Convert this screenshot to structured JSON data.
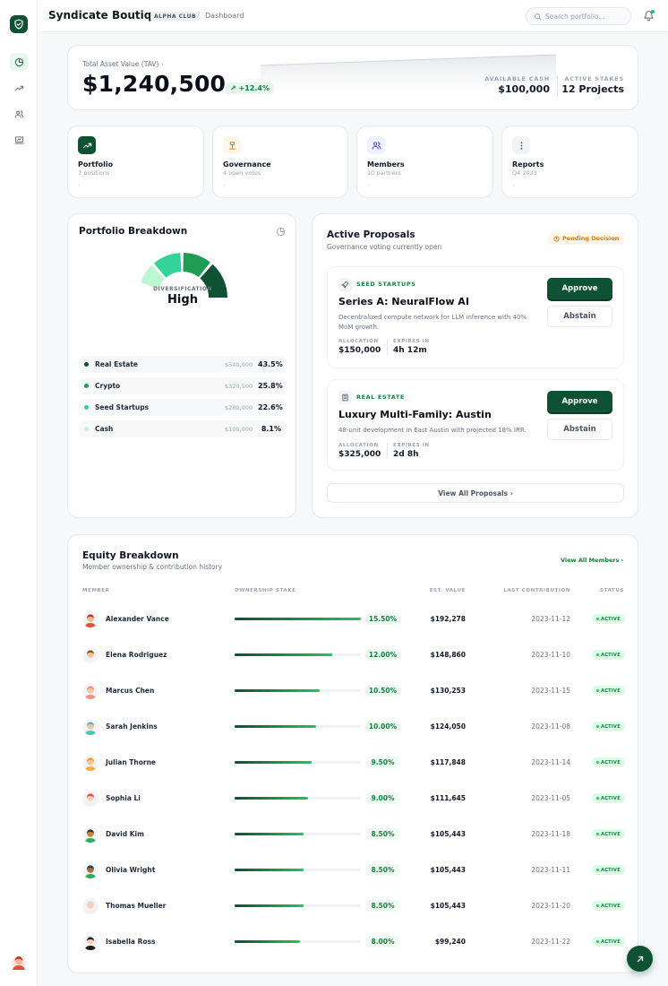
{
  "app": {
    "title": "Syndicate Boutique",
    "badge": "ALPHA CLUB",
    "crumb": "Dashboard"
  },
  "search": {
    "placeholder": "Search portfolio..."
  },
  "sidebar": {
    "items": [
      "pie-chart-icon",
      "trending-up-icon",
      "users-icon",
      "presentation-icon"
    ]
  },
  "tav": {
    "label": "Total Asset Value (TAV)",
    "value": "$1,240,500",
    "change": "+12.4%",
    "cash_label": "AVAILABLE CASH",
    "cash_value": "$100,000",
    "stakes_label": "ACTIVE STAKES",
    "stakes_value": "12 Projects"
  },
  "quick": [
    {
      "title": "Portfolio",
      "sub": "7 positions",
      "icon": "trending-up-icon"
    },
    {
      "title": "Governance",
      "sub": "4 open votes",
      "icon": "gavel-icon"
    },
    {
      "title": "Members",
      "sub": "10 partners",
      "icon": "users-icon"
    },
    {
      "title": "Reports",
      "sub": "Q4 2023",
      "icon": "more-vertical-icon"
    }
  ],
  "breakdown": {
    "title": "Portfolio Breakdown",
    "div_label": "DIVERSIFICATION",
    "div_value": "High",
    "items": [
      {
        "name": "Real Estate",
        "amount": "$540,000",
        "pct": "43.5%",
        "color": "#0f5133"
      },
      {
        "name": "Crypto",
        "amount": "$320,500",
        "pct": "25.8%",
        "color": "#1f9d55"
      },
      {
        "name": "Seed Startups",
        "amount": "$280,000",
        "pct": "22.6%",
        "color": "#34d399"
      },
      {
        "name": "Cash",
        "amount": "$100,000",
        "pct": "8.1%",
        "color": "#bbf7d0"
      }
    ]
  },
  "proposals": {
    "title": "Active Proposals",
    "sub": "Governance voting currently open",
    "pending": "Pending Decision",
    "items": [
      {
        "category": "SEED STARTUPS",
        "icon": "rocket-icon",
        "title": "Series A: NeuralFlow AI",
        "desc": "Decentralized compute network for LLM inference with 40% MoM growth.",
        "alloc_label": "ALLOCATION",
        "alloc": "$150,000",
        "exp_label": "EXPIRES IN",
        "expires": "4h 12m"
      },
      {
        "category": "REAL ESTATE",
        "icon": "building-icon",
        "title": "Luxury Multi-Family: Austin",
        "desc": "48-unit development in East Austin with projected 18% IRR.",
        "alloc_label": "ALLOCATION",
        "alloc": "$325,000",
        "exp_label": "EXPIRES IN",
        "expires": "2d 8h"
      }
    ],
    "approve": "Approve",
    "abstain": "Abstain",
    "view_all": "View All Proposals"
  },
  "equity": {
    "title": "Equity Breakdown",
    "sub": "Member ownership & contribution history",
    "link": "View All Members",
    "headers": {
      "member": "MEMBER",
      "stake": "OWNERSHIP STAKE",
      "value": "EST. VALUE",
      "last": "LAST CONTRIBUTION",
      "status": "STATUS"
    },
    "rows": [
      {
        "name": "Alexander Vance",
        "stake": "15.50%",
        "value": "$192,278",
        "date": "2023-11-12",
        "status": "ACTIVE",
        "fill": 1.0,
        "hair": "#c0392b",
        "skin": "#f3b78d",
        "shirt": "#e74c3c"
      },
      {
        "name": "Elena Rodriguez",
        "stake": "12.00%",
        "value": "$148,860",
        "date": "2023-11-10",
        "status": "ACTIVE",
        "fill": 0.774,
        "hair": "#8b5a2b",
        "skin": "#f2c39b",
        "shirt": "#f5f5f5"
      },
      {
        "name": "Marcus Chen",
        "stake": "10.50%",
        "value": "$130,253",
        "date": "2023-11-15",
        "status": "ACTIVE",
        "fill": 0.677,
        "hair": "#f1948a",
        "skin": "#f6c6a6",
        "shirt": "#f1948a"
      },
      {
        "name": "Sarah Jenkins",
        "stake": "10.00%",
        "value": "$124,050",
        "date": "2023-11-08",
        "status": "ACTIVE",
        "fill": 0.645,
        "hair": "#5dade2",
        "skin": "#f3c4a1",
        "shirt": "#48c9b0"
      },
      {
        "name": "Julian Thorne",
        "stake": "9.50%",
        "value": "$117,848",
        "date": "2023-11-14",
        "status": "ACTIVE",
        "fill": 0.613,
        "hair": "#f39c12",
        "skin": "#f6c6a6",
        "shirt": "#f5b041"
      },
      {
        "name": "Sophia Li",
        "stake": "9.00%",
        "value": "$111,645",
        "date": "2023-11-05",
        "status": "ACTIVE",
        "fill": 0.581,
        "hair": "#e74c3c",
        "skin": "#f8d0b6",
        "shirt": "#f1f1f1"
      },
      {
        "name": "David Kim",
        "stake": "8.50%",
        "value": "$105,443",
        "date": "2023-11-18",
        "status": "ACTIVE",
        "fill": 0.548,
        "hair": "#4a2c17",
        "skin": "#c68642",
        "shirt": "#27ae60"
      },
      {
        "name": "Olivia Wright",
        "stake": "8.50%",
        "value": "$105,443",
        "date": "2023-11-11",
        "status": "ACTIVE",
        "fill": 0.548,
        "hair": "#2c3e50",
        "skin": "#a86b3c",
        "shirt": "#27ae60"
      },
      {
        "name": "Thomas Mueller",
        "stake": "8.50%",
        "value": "$105,443",
        "date": "2023-11-20",
        "status": "ACTIVE",
        "fill": 0.548,
        "hair": "#d5d8dc",
        "skin": "#f8d0b6",
        "shirt": "#f1f1f1"
      },
      {
        "name": "Isabella Ross",
        "stake": "8.00%",
        "value": "$99,240",
        "date": "2023-11-22",
        "status": "ACTIVE",
        "fill": 0.516,
        "hair": "#1b1b1b",
        "skin": "#f8d0b6",
        "shirt": "#1b1b1b"
      }
    ]
  },
  "colors": {
    "brand": "#0f5133",
    "accent": "#22c55e",
    "warning": "#d97706"
  }
}
